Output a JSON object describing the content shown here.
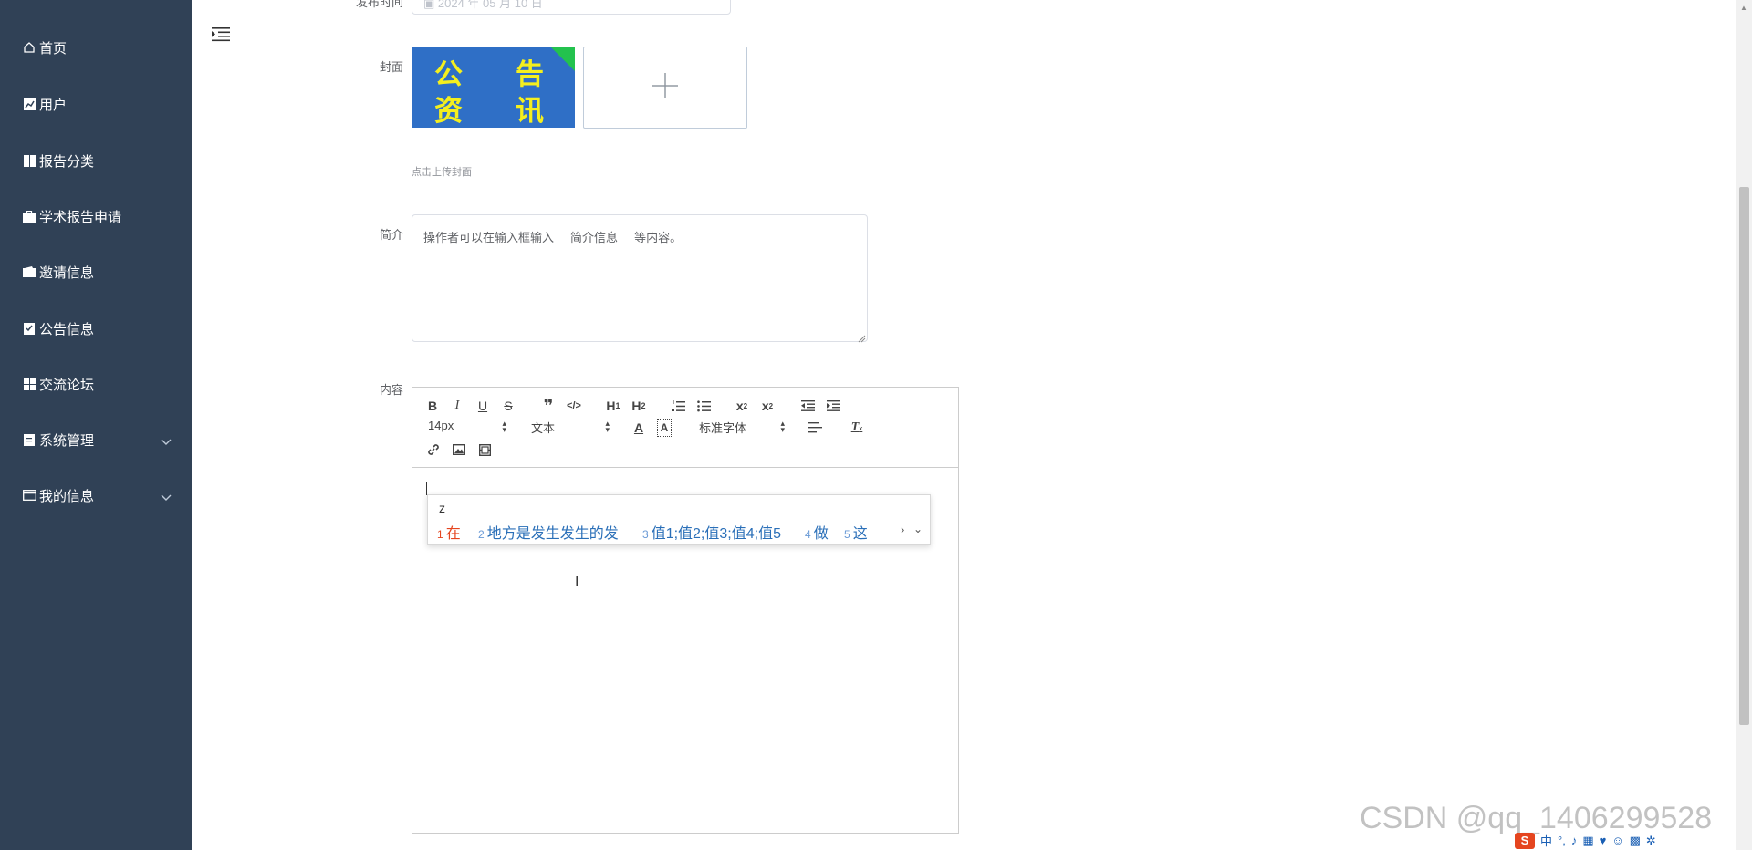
{
  "sidebar": {
    "items": [
      {
        "label": "首页",
        "icon": "home-icon"
      },
      {
        "label": "用户",
        "icon": "chart-icon"
      },
      {
        "label": "报告分类",
        "icon": "grid-icon"
      },
      {
        "label": "学术报告申请",
        "icon": "briefcase-icon"
      },
      {
        "label": "邀请信息",
        "icon": "wallet-icon"
      },
      {
        "label": "公告信息",
        "icon": "clipboard-icon"
      },
      {
        "label": "交流论坛",
        "icon": "grid-icon"
      },
      {
        "label": "系统管理",
        "icon": "clipboard-icon",
        "expandable": true
      },
      {
        "label": "我的信息",
        "icon": "card-icon",
        "expandable": true
      }
    ]
  },
  "form": {
    "publish_time": {
      "label": "发布时间",
      "value": "2024 年 05 月 10 日"
    },
    "cover": {
      "label": "封面",
      "image_text": [
        "公",
        "告",
        "资",
        "讯"
      ],
      "upload_tip": "点击上传封面"
    },
    "summary": {
      "label": "简介",
      "value": "操作者可以在输入框输入     简介信息     等内容。"
    },
    "content": {
      "label": "内容",
      "toolbar": {
        "font_size": "14px",
        "header": "文本",
        "font_family": "标准字体"
      }
    }
  },
  "ime": {
    "input": "z",
    "candidates": [
      {
        "num": "1",
        "text": "在"
      },
      {
        "num": "2",
        "text": "地方是发生发生的发"
      },
      {
        "num": "3",
        "text": "值1;值2;值3;值4;值5"
      },
      {
        "num": "4",
        "text": "做"
      },
      {
        "num": "5",
        "text": "这"
      }
    ]
  },
  "watermark": "CSDN @qq_1406299528",
  "tray": {
    "logo": "S",
    "lang": "中"
  },
  "colors": {
    "sidebar_bg": "#304156",
    "ime_highlight": "#e5451f",
    "ime_candidate": "#2a6fb8"
  }
}
